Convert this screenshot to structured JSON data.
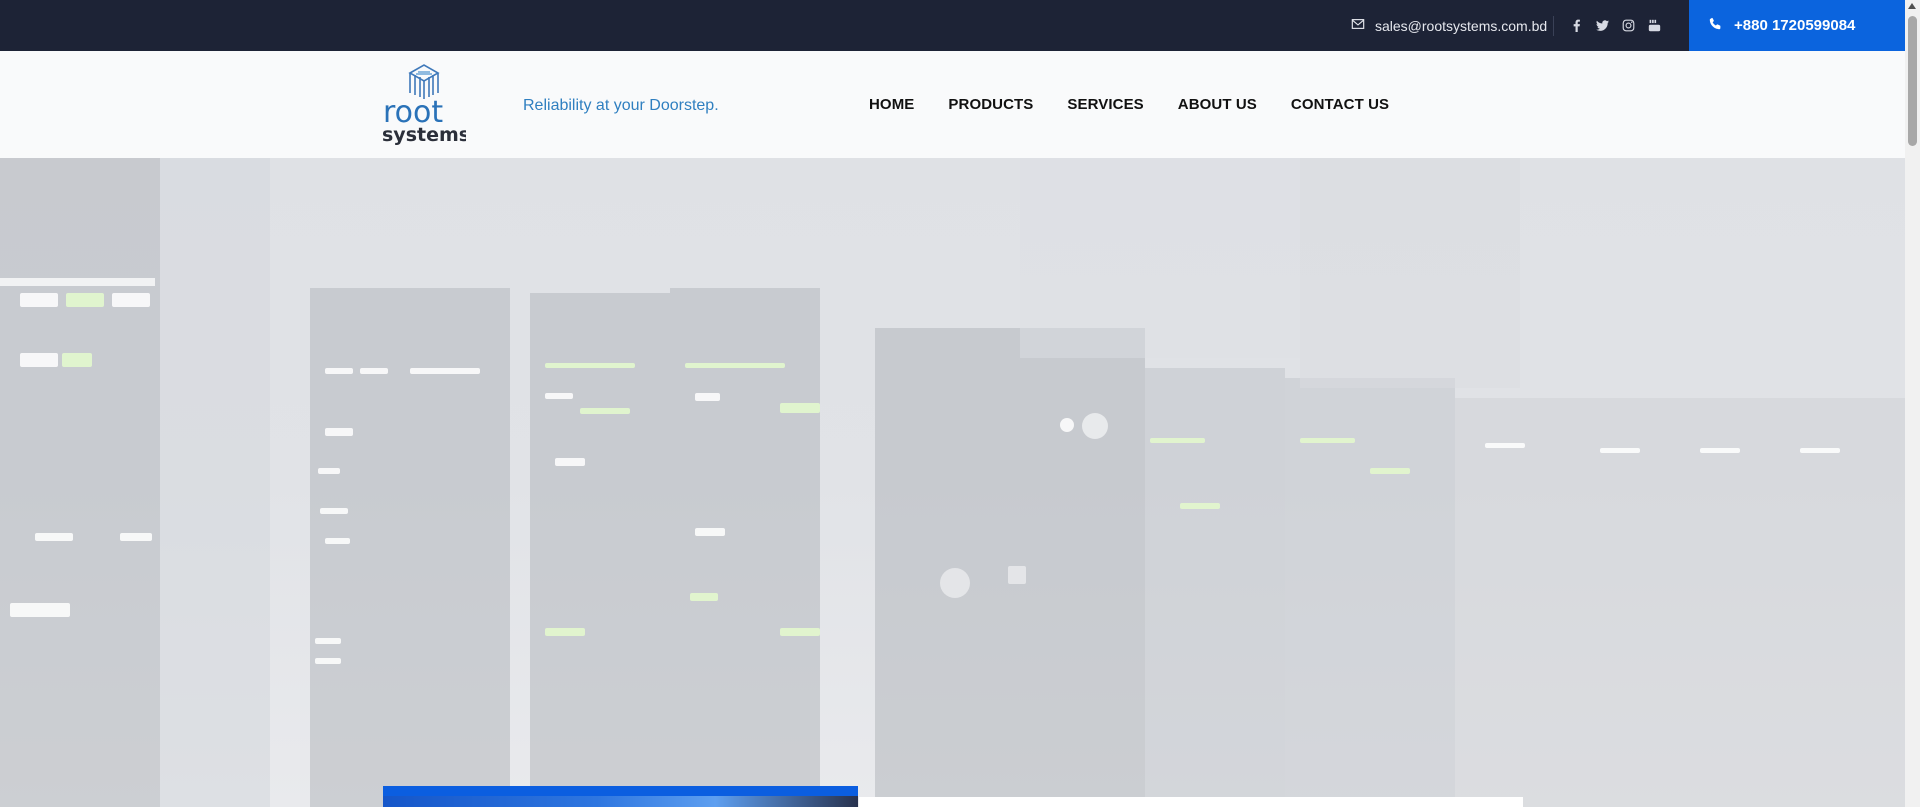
{
  "topbar": {
    "email": "sales@rootsystems.com.bd",
    "email_icon": "envelope-icon",
    "social_icons": [
      "facebook-icon",
      "twitter-icon",
      "instagram-icon",
      "youtube-icon"
    ],
    "phone": "+880 1720599084",
    "phone_icon": "phone-icon"
  },
  "header": {
    "logo_text_top": "root",
    "logo_text_bottom": "systems",
    "tagline": "Reliability at your Doorstep.",
    "nav": [
      "HOME",
      "PRODUCTS",
      "SERVICES",
      "ABOUT US",
      "CONTACT US"
    ]
  },
  "colors": {
    "topbar": "#1d2336",
    "accent_blue": "#0b64de",
    "tagline": "#2f7fc0"
  }
}
